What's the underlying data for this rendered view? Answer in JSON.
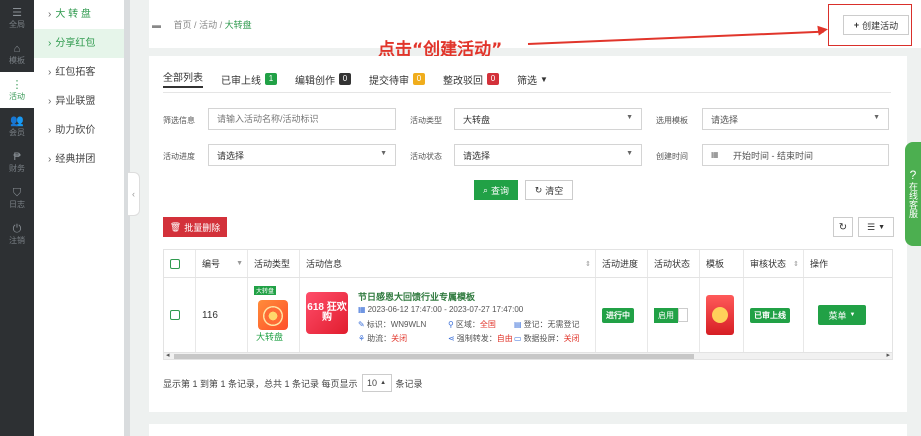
{
  "rail": [
    {
      "icon": "sliders-icon",
      "glyph": "☰",
      "label": "全局"
    },
    {
      "icon": "template-icon",
      "glyph": "⌂",
      "label": "模板"
    },
    {
      "icon": "activity-icon",
      "glyph": "⋮",
      "label": "活动"
    },
    {
      "icon": "members-icon",
      "glyph": "👥",
      "label": "会员"
    },
    {
      "icon": "finance-icon",
      "glyph": "₱",
      "label": "财务"
    },
    {
      "icon": "shield-icon",
      "glyph": "⛉",
      "label": "日志"
    },
    {
      "icon": "power-icon",
      "glyph": "⏻",
      "label": "注销"
    }
  ],
  "submenu": [
    {
      "label": "大 转 盘"
    },
    {
      "label": "分享红包"
    },
    {
      "label": "红包拓客"
    },
    {
      "label": "异业联盟"
    },
    {
      "label": "助力砍价"
    },
    {
      "label": "经典拼团"
    }
  ],
  "breadcrumb": {
    "home": "首页",
    "sep": "/",
    "section": "活动",
    "current": "大转盘"
  },
  "create_button": "创建活动",
  "annotation": "点击“创建活动”",
  "tabs": [
    {
      "label": "全部列表",
      "badge": ""
    },
    {
      "label": "已审上线",
      "badge": "1",
      "color": "#21a146"
    },
    {
      "label": "编辑创作",
      "badge": "0",
      "color": "#333333"
    },
    {
      "label": "提交待审",
      "badge": "0",
      "color": "#f0ad1c"
    },
    {
      "label": "整改驳回",
      "badge": "0",
      "color": "#d3313a"
    },
    {
      "label": "筛选",
      "badge": ""
    }
  ],
  "filters": {
    "search_label": "筛选信息",
    "search_placeholder": "请输入活动名称/活动标识",
    "type_label": "活动类型",
    "type_value": "大转盘",
    "template_label": "选用模板",
    "template_value": "请选择",
    "progress_label": "活动进度",
    "progress_value": "请选择",
    "status_label": "活动状态",
    "status_value": "请选择",
    "time_label": "创建时间",
    "time_value": "开始时间 - 结束时间"
  },
  "buttons": {
    "search": "查询",
    "clear": "清空",
    "bulk_delete": "批量删除"
  },
  "table": {
    "headers": [
      "编号",
      "活动类型",
      "活动信息",
      "活动进度",
      "活动状态",
      "模板",
      "审核状态",
      "操作"
    ],
    "rows": [
      {
        "id": "116",
        "type_tag": "大转盘",
        "type": "大转盘",
        "info_image_text": "618 狂欢购",
        "title": "节日感恩大回馈行业专属模板",
        "time": "2023-06-12 17:47:00 - 2023-07-27 17:47:00",
        "tag": "标识：WN9WLN",
        "region_label": "区域：",
        "region": "全国",
        "register": "登记：无需登记",
        "traffic_label": "助流：",
        "traffic": "关闭",
        "share_label": "强制转发：",
        "share": "自由",
        "data_label": "数据投屏：",
        "data": "关闭",
        "progress": "进行中",
        "status": "启用",
        "review": "已审上线",
        "menu": "菜单"
      }
    ]
  },
  "pager": {
    "text": "显示第 1 到第 1 条记录，总共 1 条记录 每页显示",
    "size": "10",
    "suffix": "条记录"
  },
  "service": {
    "label": "在线客服"
  }
}
